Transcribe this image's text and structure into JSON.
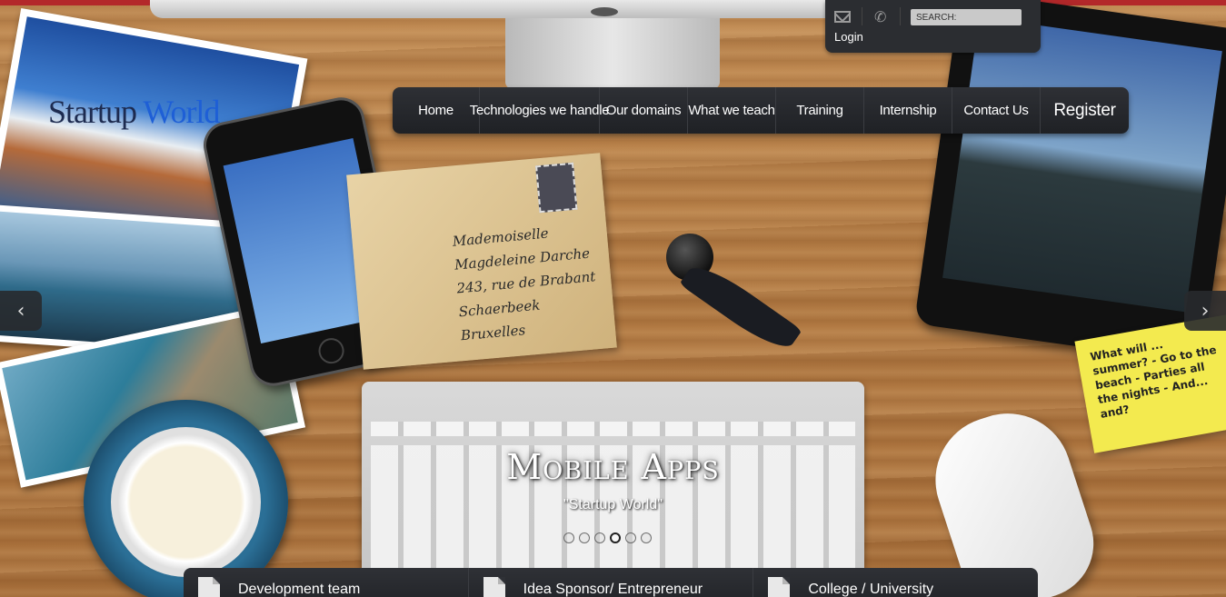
{
  "site": {
    "logo_part1": "Startup ",
    "logo_part2": "World"
  },
  "utility": {
    "search_placeholder": "SEARCH:",
    "login_label": "Login",
    "mail_icon": "mail-icon",
    "phone_icon": "phone-icon"
  },
  "nav": {
    "items": [
      {
        "label": "Home"
      },
      {
        "label": "Technologies we handle"
      },
      {
        "label": "Our domains"
      },
      {
        "label": "What we teach"
      },
      {
        "label": "Training"
      },
      {
        "label": "Internship"
      },
      {
        "label": "Contact Us"
      },
      {
        "label": "Register"
      }
    ]
  },
  "slider": {
    "title": "Mobile Apps",
    "subtitle": "\"Startup World\"",
    "prev_icon": "‹",
    "next_icon": "›",
    "slide_count": 6,
    "active_index": 3
  },
  "scene": {
    "postcard_text": "Mademoiselle Magdeleine Darche 243, rue de Brabant Schaerbeek Bruxelles",
    "sticky_text": "What will ... summer? - Go to the beach - Parties all the nights - And... and?"
  },
  "bottom_tabs": [
    {
      "label": "Development team"
    },
    {
      "label": "Idea Sponsor/ Entrepreneur"
    },
    {
      "label": "College / University"
    }
  ],
  "colors": {
    "top_accent": "#b3282a",
    "nav_bg": "#2b2d31"
  }
}
